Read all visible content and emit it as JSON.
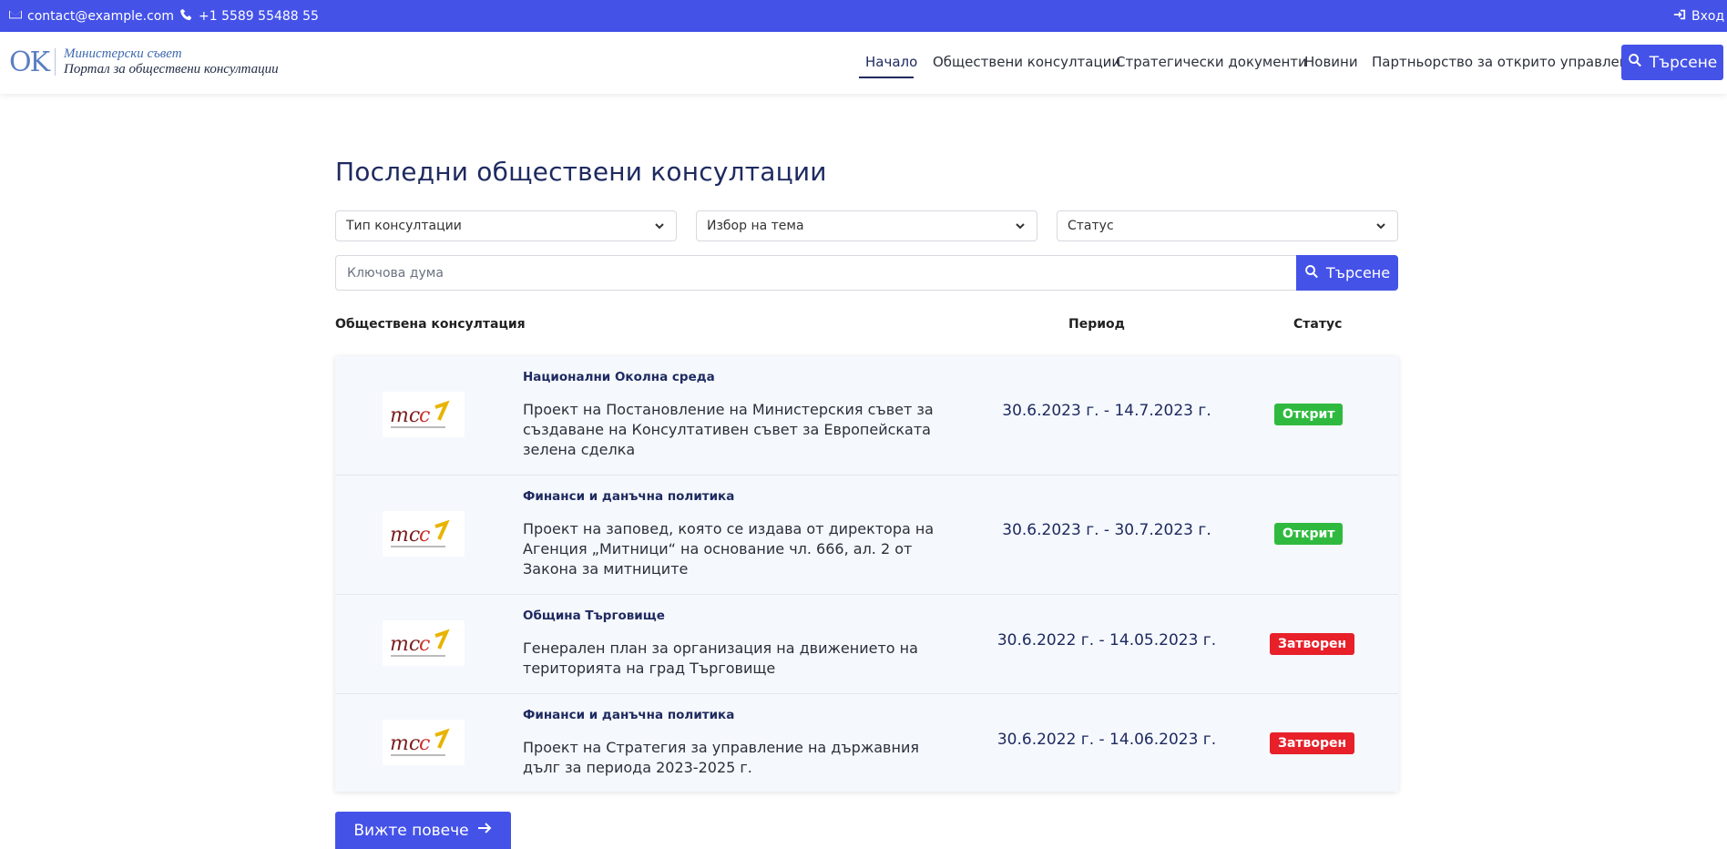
{
  "topbar": {
    "email": "contact@example.com",
    "phone": "+1 5589 55488 55",
    "login": "Вход"
  },
  "header": {
    "logo_mark": "OK",
    "logo_line1": "Министерски съвет",
    "logo_line2": "Портал за обществени консултации",
    "nav": [
      "Начало",
      "Обществени консултации",
      "Стратегически документи",
      "Новини",
      "Партньорство за открито управление"
    ],
    "search_label": "Търсене"
  },
  "main": {
    "title": "Последни обществени консултации",
    "filters": {
      "type": "Тип консултации",
      "topic": "Избор на тема",
      "status": "Статус"
    },
    "keyword_placeholder": "Ключова дума",
    "search_label": "Търсене",
    "columns": {
      "consultation": "Обществена консултация",
      "period": "Период",
      "status": "Статус"
    },
    "rows": [
      {
        "category": "Национални Околна среда",
        "description": "Проект на Постановление на Министерския съвет за създаване на Консултативен съвет за Европейската зелена сделка",
        "period": "30.6.2023 г. - 14.7.2023 г.",
        "status": "Открит",
        "status_color": "#2fba3f"
      },
      {
        "category": "Финанси и данъчна политика",
        "description": "Проект на заповед, която се издава от директора на Агенция „Митници“ на основание чл. 666, ал. 2 от Закона за митниците",
        "period": "30.6.2023 г. - 30.7.2023 г.",
        "status": "Открит",
        "status_color": "#2fba3f"
      },
      {
        "category": "Община Търговище",
        "description": "Генерален план за организация на движението на територията на град Търговище",
        "period": "30.6.2022 г. - 14.05.2023 г.",
        "status": "Затворен",
        "status_color": "#e8202a"
      },
      {
        "category": "Финанси и данъчна политика",
        "description": "Проект на Стратегия за управление на държавния дълг за периода 2023-2025 г.",
        "period": "30.6.2022 г. - 14.06.2023 г.",
        "status": "Затворен",
        "status_color": "#e8202a"
      }
    ],
    "more_label": "Вижте повече"
  },
  "colors": {
    "primary": "#4452e8",
    "navy": "#1e2a60",
    "open": "#2fba3f",
    "closed": "#e8202a"
  },
  "icons": [
    "envelope-icon",
    "phone-icon",
    "login-icon",
    "search-icon",
    "chevron-down-icon",
    "arrow-right-icon"
  ]
}
